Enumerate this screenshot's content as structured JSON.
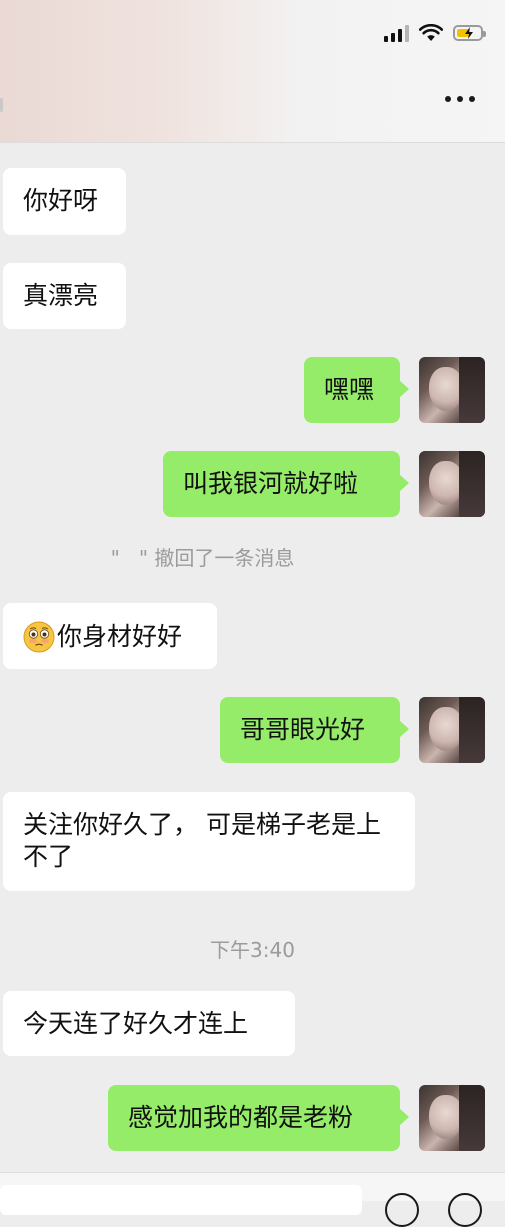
{
  "status_bar": {
    "signal_icon": "cellular-signal-icon",
    "wifi_icon": "wifi-icon",
    "battery_icon": "battery-charging-icon"
  },
  "nav": {
    "more_icon": "more-dots-icon"
  },
  "messages": [
    {
      "side": "in",
      "text": "你好呀"
    },
    {
      "side": "in",
      "text": "真漂亮"
    },
    {
      "side": "out",
      "text": "嘿嘿"
    },
    {
      "side": "out",
      "text": "叫我银河就好啦"
    },
    {
      "side": "system",
      "text": "\"   \" 撤回了一条消息"
    },
    {
      "side": "in",
      "emoji": "flushed-face-emoji",
      "text": "你身材好好"
    },
    {
      "side": "out",
      "text": "哥哥眼光好"
    },
    {
      "side": "in",
      "text": "关注你好久了， 可是梯子老是上不了"
    },
    {
      "side": "system",
      "text": "下午3:40"
    },
    {
      "side": "in",
      "text": "今天连了好久才连上"
    },
    {
      "side": "out",
      "text": "感觉加我的都是老粉"
    }
  ],
  "colors": {
    "background": "#ededed",
    "incoming_bubble": "#ffffff",
    "outgoing_bubble": "#95ec69",
    "system_text": "#9b9b9b",
    "battery_fill": "#f2c200"
  }
}
